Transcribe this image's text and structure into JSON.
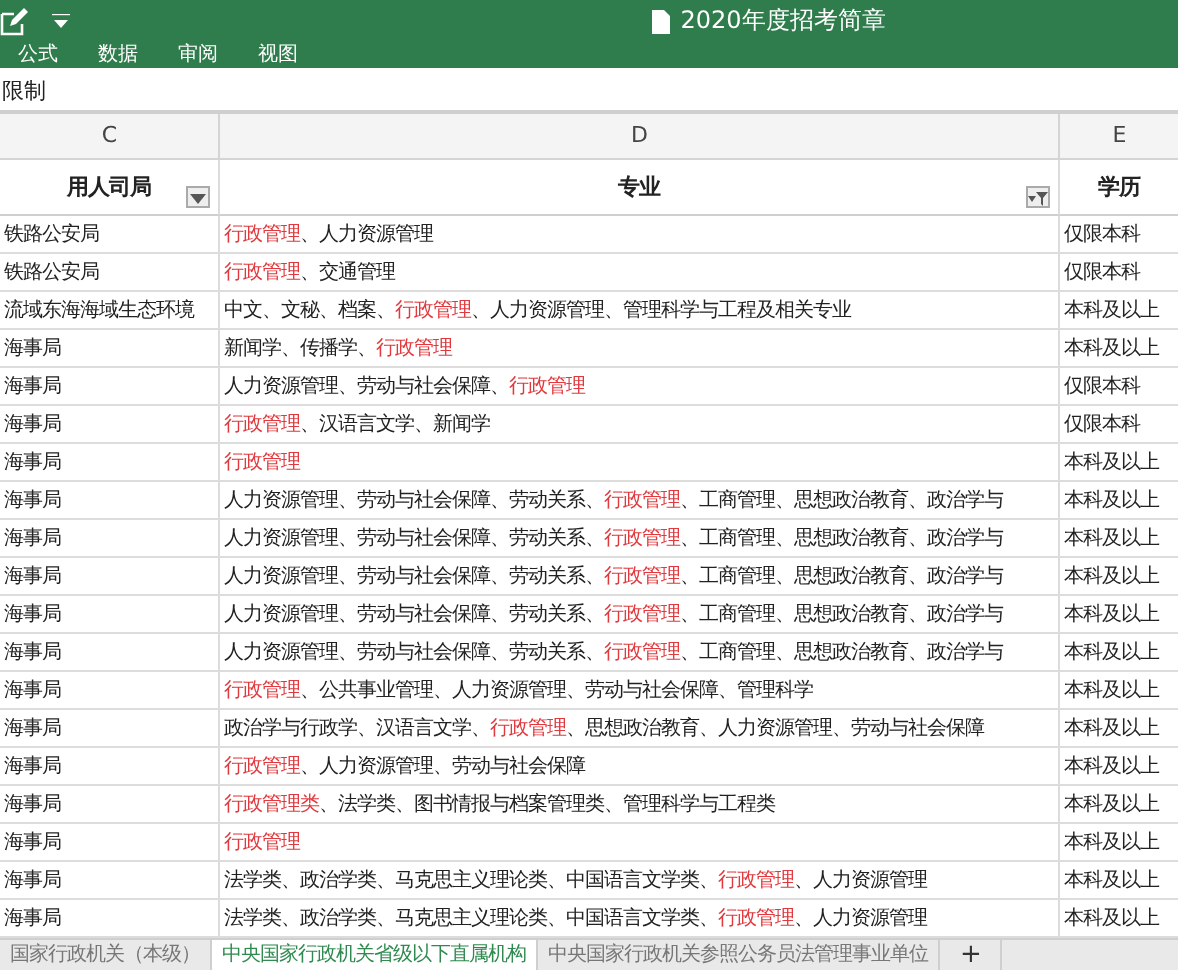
{
  "window": {
    "title": "2020年度招考简章"
  },
  "ribbon_tabs": [
    {
      "label": "公式"
    },
    {
      "label": "数据"
    },
    {
      "label": "审阅"
    },
    {
      "label": "视图"
    }
  ],
  "formula_bar": {
    "value": "限制"
  },
  "columns": [
    {
      "letter": "C",
      "header": "用人司局",
      "filter_applied": false
    },
    {
      "letter": "D",
      "header": "专业",
      "filter_applied": true
    },
    {
      "letter": "E",
      "header": "学历"
    }
  ],
  "rows": [
    {
      "c": "铁路公安局",
      "d": [
        {
          "text": "行政管理",
          "highlight": true
        },
        {
          "text": "、人力资源管理",
          "highlight": false
        }
      ],
      "e": "仅限本科"
    },
    {
      "c": "铁路公安局",
      "d": [
        {
          "text": "行政管理",
          "highlight": true
        },
        {
          "text": "、交通管理",
          "highlight": false
        }
      ],
      "e": "仅限本科"
    },
    {
      "c": "流域东海海域生态环境",
      "d": [
        {
          "text": "中文、文秘、档案、",
          "highlight": false
        },
        {
          "text": "行政管理",
          "highlight": true
        },
        {
          "text": "、人力资源管理、管理科学与工程及相关专业",
          "highlight": false
        }
      ],
      "e": "本科及以上"
    },
    {
      "c": "海事局",
      "d": [
        {
          "text": "新闻学、传播学、",
          "highlight": false
        },
        {
          "text": "行政管理",
          "highlight": true
        }
      ],
      "e": "本科及以上"
    },
    {
      "c": "海事局",
      "d": [
        {
          "text": "人力资源管理、劳动与社会保障、",
          "highlight": false
        },
        {
          "text": "行政管理",
          "highlight": true
        }
      ],
      "e": "仅限本科"
    },
    {
      "c": "海事局",
      "d": [
        {
          "text": "行政管理",
          "highlight": true
        },
        {
          "text": "、汉语言文学、新闻学",
          "highlight": false
        }
      ],
      "e": "仅限本科"
    },
    {
      "c": "海事局",
      "d": [
        {
          "text": "行政管理",
          "highlight": true
        }
      ],
      "e": "本科及以上"
    },
    {
      "c": "海事局",
      "d": [
        {
          "text": "人力资源管理、劳动与社会保障、劳动关系、",
          "highlight": false
        },
        {
          "text": "行政管理",
          "highlight": true
        },
        {
          "text": "、工商管理、思想政治教育、政治学与",
          "highlight": false
        }
      ],
      "e": "本科及以上"
    },
    {
      "c": "海事局",
      "d": [
        {
          "text": "人力资源管理、劳动与社会保障、劳动关系、",
          "highlight": false
        },
        {
          "text": "行政管理",
          "highlight": true
        },
        {
          "text": "、工商管理、思想政治教育、政治学与",
          "highlight": false
        }
      ],
      "e": "本科及以上"
    },
    {
      "c": "海事局",
      "d": [
        {
          "text": "人力资源管理、劳动与社会保障、劳动关系、",
          "highlight": false
        },
        {
          "text": "行政管理",
          "highlight": true
        },
        {
          "text": "、工商管理、思想政治教育、政治学与",
          "highlight": false
        }
      ],
      "e": "本科及以上"
    },
    {
      "c": "海事局",
      "d": [
        {
          "text": "人力资源管理、劳动与社会保障、劳动关系、",
          "highlight": false
        },
        {
          "text": "行政管理",
          "highlight": true
        },
        {
          "text": "、工商管理、思想政治教育、政治学与",
          "highlight": false
        }
      ],
      "e": "本科及以上"
    },
    {
      "c": "海事局",
      "d": [
        {
          "text": "人力资源管理、劳动与社会保障、劳动关系、",
          "highlight": false
        },
        {
          "text": "行政管理",
          "highlight": true
        },
        {
          "text": "、工商管理、思想政治教育、政治学与",
          "highlight": false
        }
      ],
      "e": "本科及以上"
    },
    {
      "c": "海事局",
      "d": [
        {
          "text": "行政管理",
          "highlight": true
        },
        {
          "text": "、公共事业管理、人力资源管理、劳动与社会保障、管理科学",
          "highlight": false
        }
      ],
      "e": "本科及以上"
    },
    {
      "c": "海事局",
      "d": [
        {
          "text": "政治学与行政学、汉语言文学、",
          "highlight": false
        },
        {
          "text": "行政管理",
          "highlight": true
        },
        {
          "text": "、思想政治教育、人力资源管理、劳动与社会保障",
          "highlight": false
        }
      ],
      "e": "本科及以上"
    },
    {
      "c": "海事局",
      "d": [
        {
          "text": "行政管理",
          "highlight": true
        },
        {
          "text": "、人力资源管理、劳动与社会保障",
          "highlight": false
        }
      ],
      "e": "本科及以上"
    },
    {
      "c": "海事局",
      "d": [
        {
          "text": "行政管理类",
          "highlight": true
        },
        {
          "text": "、法学类、图书情报与档案管理类、管理科学与工程类",
          "highlight": false
        }
      ],
      "e": "本科及以上"
    },
    {
      "c": "海事局",
      "d": [
        {
          "text": "行政管理",
          "highlight": true
        }
      ],
      "e": "本科及以上"
    },
    {
      "c": "海事局",
      "d": [
        {
          "text": "法学类、政治学类、马克思主义理论类、中国语言文学类、",
          "highlight": false
        },
        {
          "text": "行政管理",
          "highlight": true
        },
        {
          "text": "、人力资源管理",
          "highlight": false
        }
      ],
      "e": "本科及以上"
    },
    {
      "c": "海事局",
      "d": [
        {
          "text": "法学类、政治学类、马克思主义理论类、中国语言文学类、",
          "highlight": false
        },
        {
          "text": "行政管理",
          "highlight": true
        },
        {
          "text": "、人力资源管理",
          "highlight": false
        }
      ],
      "e": "本科及以上"
    }
  ],
  "sheet_tabs": [
    {
      "label": "国家行政机关（本级）",
      "selected": false
    },
    {
      "label": "中央国家行政机关省级以下直属机构",
      "selected": true
    },
    {
      "label": "中央国家行政机关参照公务员法管理事业单位",
      "selected": false
    }
  ],
  "add_sheet": "+"
}
